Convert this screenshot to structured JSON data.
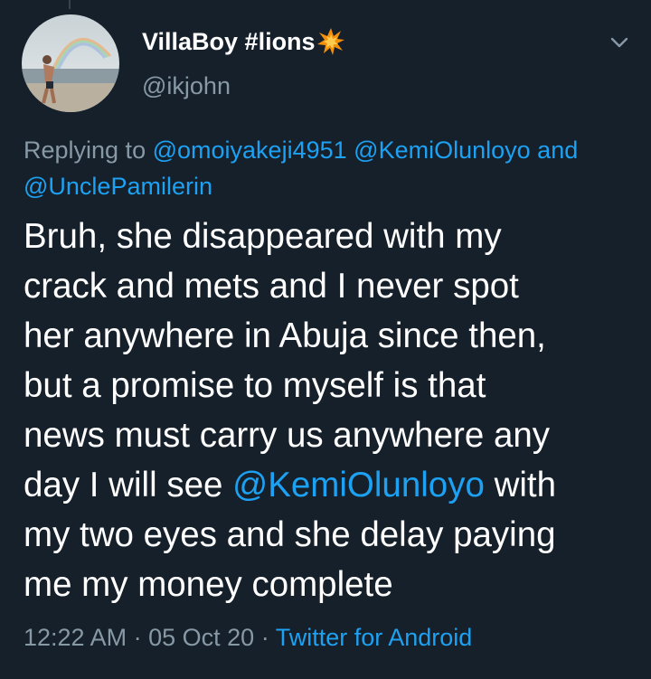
{
  "tweet": {
    "author": {
      "display_name": "VillaBoy #lions",
      "emoji": "collision-emoji",
      "handle": "@ikjohn"
    },
    "reply_to": {
      "prefix": "Replying to",
      "mention_1": "@omoiyakeji4951",
      "mention_2": "@KemiOlunloyo",
      "conjunction": "and",
      "mention_3": "@UnclePamilerin"
    },
    "body": {
      "line_1": "Bruh, she disappeared with my",
      "line_2": "crack and mets and I never spot",
      "line_3": "her anywhere in Abuja since then,",
      "line_4": "but a promise to myself is that",
      "line_5": "news must carry us anywhere any",
      "line_6_before": "day I will see",
      "line_6_mention": "@KemiOlunloyo",
      "line_6_after": "with",
      "line_7": "my two eyes and she delay paying",
      "line_8": "me my money complete"
    },
    "meta": {
      "time": "12:22 AM",
      "separator": "·",
      "date": "05 Oct 20",
      "source": "Twitter for Android"
    }
  },
  "colors": {
    "background": "#15202b",
    "text_primary": "#ffffff",
    "text_secondary": "#8899a6",
    "link": "#1da1f2"
  }
}
